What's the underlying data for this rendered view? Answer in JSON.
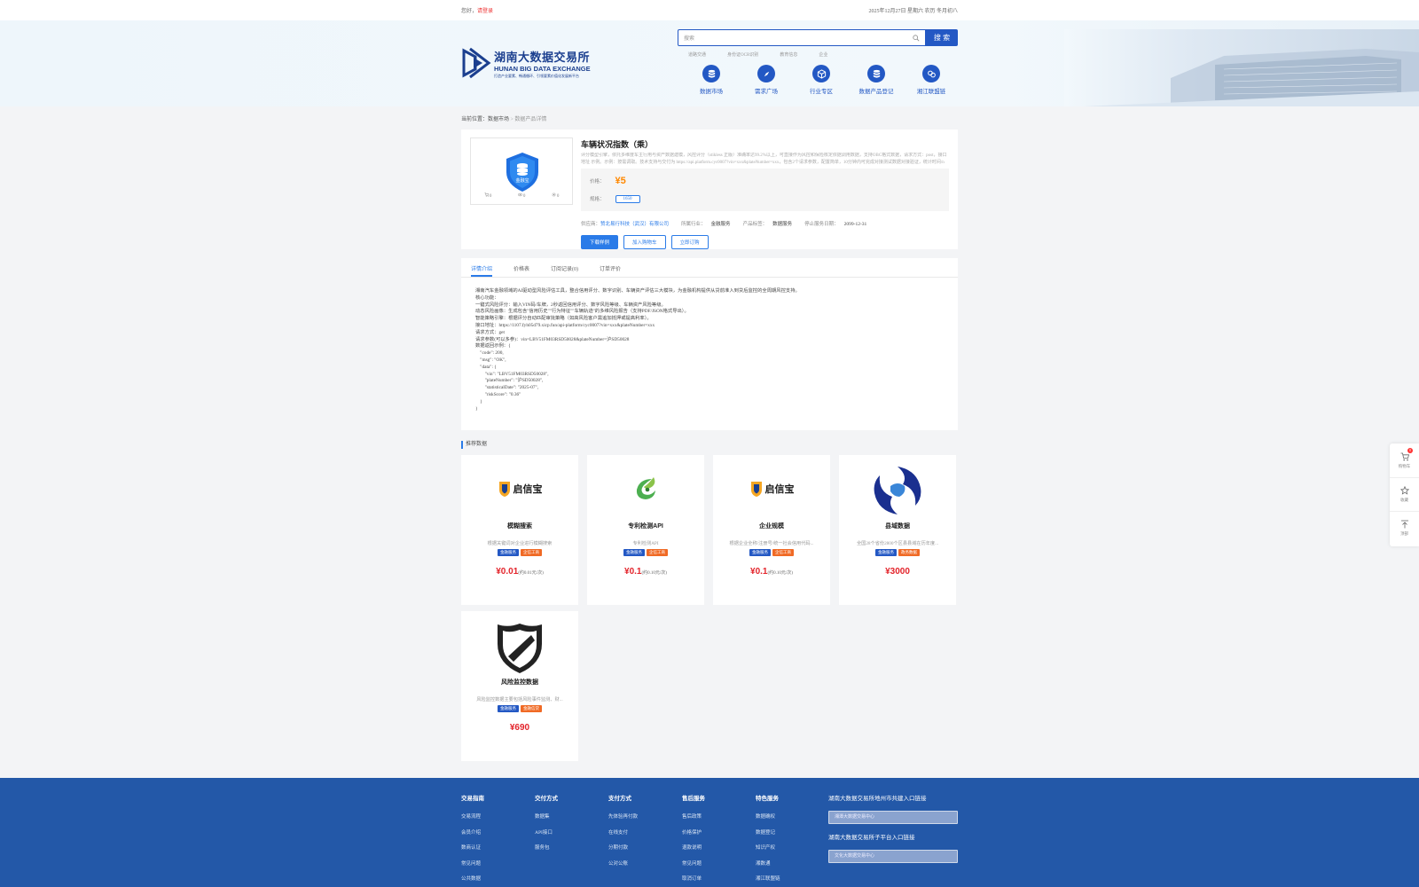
{
  "topbar": {
    "greeting": "您好，",
    "login": "请登录",
    "date": "2025年12月27日 星期六 农历 冬月初八"
  },
  "header": {
    "logo_cn": "湖南大数据交易所",
    "logo_en": "HUNAN BIG DATA EXCHANGE",
    "logo_slogan": "打造产业要素、畅通循环、引领要素价值化发展新平台",
    "search_placeholder": "搜索",
    "search_button": "搜 索",
    "hot": [
      "道路交通",
      "身份证OCR识别",
      "教育信息",
      "企业"
    ],
    "nav": [
      {
        "label": "数据市场",
        "icon": "database-icon"
      },
      {
        "label": "需求广场",
        "icon": "compass-icon"
      },
      {
        "label": "行业专区",
        "icon": "cube-icon"
      },
      {
        "label": "数据产品登记",
        "icon": "database-icon"
      },
      {
        "label": "湘江联盟链",
        "icon": "link-icon"
      }
    ]
  },
  "breadcrumb": {
    "prefix": "当前位置：",
    "market": "数据市场",
    "sep": " > ",
    "current": "数据产品详情"
  },
  "product": {
    "title": "车辆状况指数（乘）",
    "desc": "评分模型引擎，依托多维度车主行用与资产数据建模，风控评分（stikless 正版）准确率达99.2%以上，可直接作为风控和保险核定依据调用数据，支持OBC格式数据，请求方式：post，接口地址 示例。示例：按需调取。技术支持与交付为 https://api.platform.cyc0007?vin=xxx&plateNumber=xxx，包含2个请求参数，配置简单，10分钟内可完成对接测试数据对接验证，统计时间/n",
    "price_label": "价格：",
    "price": "¥5",
    "spec_label": "规格：",
    "spec": "1650",
    "actions": [
      "0",
      "0",
      "0"
    ],
    "supplier_label": "供应商：",
    "supplier": "赞北易行科技（武汉）有限公司",
    "industry_label": "所属行业：",
    "industry": "金融服务",
    "tag_label": "产品标签：",
    "tag": "数据服务",
    "end_label": "停止服务日期：",
    "end": "2099-12-31",
    "btn_download": "下载样例",
    "btn_cart": "加入购物车",
    "btn_buy": "立即订购"
  },
  "tabs": [
    "详情介绍",
    "价格表",
    "订阅记录(0)",
    "订单评价"
  ],
  "detail_lines": [
    "湘南汽车金融领域的AI驱动型风险评估工具，整合信用评分、数字识别、车辆资产评估三大模块，为金融机构提供从贷前准入到贷后监控的全周期风控支持。",
    "核心功能：",
    "一键式风险评分：输入VIN码/车牌，2秒返回信用评分、数字风险等级、车辆资产风险等级。",
    "动态风险画像：生成包含\"信用历史\"\"行为特征\"\"车辆轨迹\"的多维风险报告（支持PDF/JSON格式导出）。",
    "智能策略引擎：根据评分自动匹配审批策略（如高风险客户需追加抵押或提高利率）。",
    "接口地址：https://1107.fyh05d79.xicp.fun/api-platform/cyc0007?vin=xxx&plateNumber=xxx",
    "请求方式：get",
    "请求参数(可以多参)：vin=LBV51FM03RSD50028&plateNumber=沪SD50028",
    "数据返回示例：{",
    "    \"code\": 200,",
    "    \"msg\": \"OK\",",
    "    \"data\": {",
    "        \"vin\": \"LBV51FM03RSD50028\",",
    "        \"plateNumber\": \"沪SD50028\",",
    "        \"statisticalDate\": \"2025-07\",",
    "        \"riskScore\": \"0.36\"",
    "    }",
    "}"
  ],
  "recommend": {
    "title": "推荐数据",
    "items": [
      {
        "name": "模糊搜索",
        "desc": "根据关键词对企业进行模糊搜索",
        "tags": [
          "金融服务",
          "企信工商"
        ],
        "price": "¥0.01",
        "unit": "(约0.01元/次)",
        "logo": "qixinbao-logo",
        "logo_text": "启信宝"
      },
      {
        "name": "专利检测API",
        "desc": "专利检测API",
        "tags": [
          "金融服务",
          "企信工商"
        ],
        "price": "¥0.1",
        "unit": "(约0.10元/次)",
        "logo": "leaf-logo",
        "logo_text": ""
      },
      {
        "name": "企业规模",
        "desc": "根据企业全称/注册号/统一社会信用代码...",
        "tags": [
          "金融服务",
          "企信工商"
        ],
        "price": "¥0.1",
        "unit": "(约0.10元/次)",
        "logo": "qixinbao-logo",
        "logo_text": "启信宝"
      },
      {
        "name": "县域数据",
        "desc": "全国28个省份2800个区县县域在历年度...",
        "tags": [
          "金融服务",
          "政务数据"
        ],
        "price": "¥3000",
        "unit": "",
        "logo": "swirl-logo",
        "logo_text": ""
      },
      {
        "name": "风险监控数据",
        "desc": "风险监控数据主要包括风险事件监测、财...",
        "tags": [
          "金融服务",
          "金融信贷"
        ],
        "price": "¥690",
        "unit": "",
        "logo": "shield-logo",
        "logo_text": ""
      }
    ]
  },
  "footer": {
    "cols": [
      {
        "title": "交易指南",
        "items": [
          "交易流程",
          "会员介绍",
          "数商认证",
          "常见问题",
          "公共数据"
        ]
      },
      {
        "title": "交付方式",
        "items": [
          "数据集",
          "API接口",
          "服务包"
        ]
      },
      {
        "title": "支付方式",
        "items": [
          "先体验再付款",
          "在线支付",
          "分期付款",
          "公对公账"
        ]
      },
      {
        "title": "售后服务",
        "items": [
          "售后政策",
          "价格保护",
          "退款说明",
          "常见问题",
          "取消订单"
        ]
      },
      {
        "title": "特色服务",
        "items": [
          "数据确权",
          "数据登记",
          "知识产权",
          "湘数通",
          "湘江联盟链"
        ]
      }
    ],
    "link1_title": "湖南大数据交易所地州市共建入口链接",
    "link1_select": "湘潭大数据交易中心",
    "link2_title": "湖南大数据交易所子平台入口链接",
    "link2_select": "文化大数据交易中心"
  },
  "float": {
    "cart": "购物车",
    "cart_count": "0",
    "fav": "收藏",
    "top": "顶部"
  },
  "colors": {
    "brand": "#2358c4",
    "accent": "#2a7be8",
    "price": "#e3242b",
    "tag_orange": "#f06a25"
  }
}
